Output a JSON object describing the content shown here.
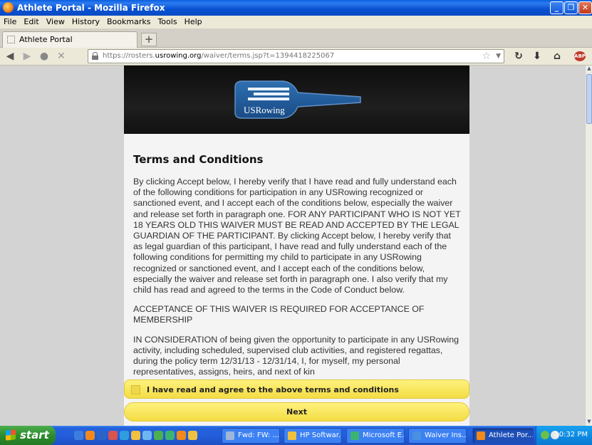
{
  "window": {
    "title": "Athlete Portal - Mozilla Firefox"
  },
  "menu": [
    "File",
    "Edit",
    "View",
    "History",
    "Bookmarks",
    "Tools",
    "Help"
  ],
  "tabs": [
    {
      "label": "Athlete Portal"
    }
  ],
  "newtab_label": "+",
  "nav": {
    "url_prefix": "https://rosters.",
    "url_domain": "usrowing.org",
    "url_path": "/waiver/terms.jsp?t=1394418225067"
  },
  "page": {
    "logo_text": "USRowing",
    "title": "Terms and Conditions",
    "paragraphs": [
      "By clicking Accept below, I hereby verify that I have read and fully understand each of the following conditions for participation in any USRowing recognized or sanctioned event, and I accept each of the conditions below, especially the waiver and release set forth in paragraph one. FOR ANY PARTICIPANT WHO IS NOT YET 18 YEARS OLD THIS WAIVER MUST BE READ AND ACCEPTED BY THE LEGAL GUARDIAN OF THE PARTICIPANT. By clicking Accept below, I hereby verify that as legal guardian of this participant, I have read and fully understand each of the following conditions for permitting my child to participate in any USRowing recognized or sanctioned event, and I accept each of the conditions below, especially the waiver and release set forth in paragraph one. I also verify that my child has read and agreed to the terms in the Code of Conduct below.",
      "ACCEPTANCE OF THIS WAIVER IS REQUIRED FOR ACCEPTANCE OF MEMBERSHIP",
      "IN CONSIDERATION of being given the opportunity to participate in any USRowing activity, including scheduled, supervised club activities, and registered regattas, during the policy term 12/31/13 - 12/31/14, I, for myself, my personal representatives, assigns, heirs, and next of kin"
    ],
    "agree_label": "I have read and agree to the above terms and conditions",
    "next_label": "Next"
  },
  "taskbar": {
    "start_label": "start",
    "buttons": [
      {
        "label": "Fwd: FW: ...",
        "color": "#9fb6d8"
      },
      {
        "label": "HP Softwar...",
        "color": "#f0c040"
      },
      {
        "label": "Microsoft E...",
        "color": "#3cb371"
      },
      {
        "label": "Waiver Ins...",
        "color": "#4a90e2"
      },
      {
        "label": "Athlete Por...",
        "color": "#f08a1c"
      }
    ],
    "clock": "10:32 PM"
  }
}
